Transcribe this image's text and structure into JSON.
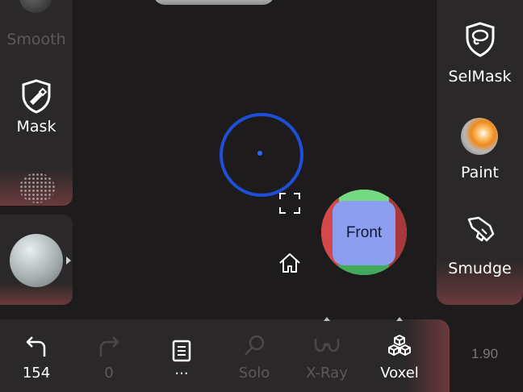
{
  "left_tools": {
    "smooth_label": "Smooth",
    "mask_label": "Mask"
  },
  "right_tools": {
    "selmask_label": "SelMask",
    "paint_label": "Paint",
    "smudge_label": "Smudge"
  },
  "view_cube": {
    "front_label": "Front"
  },
  "toolbar": {
    "undo_count": "154",
    "redo_count": "0",
    "menu_label": "...",
    "solo_label": "Solo",
    "xray_label": "X-Ray",
    "voxel_label": "Voxel"
  },
  "brush_size": "1.90",
  "colors": {
    "panel": "#2a2828",
    "panel_glow": "#6b3a3d",
    "brush_ring": "#1f4fd8",
    "cube_front": "#8b9ef0",
    "cube_green": "#51c96c",
    "cube_red": "#d6474a"
  },
  "icons": {
    "smooth": "smooth-icon",
    "mask": "shield-brush-icon",
    "stylus": "stylus-icon",
    "selmask": "shield-lasso-icon",
    "paint": "paint-ball-icon",
    "smudge": "smudge-hand-icon",
    "frame": "frame-icon",
    "home": "home-icon",
    "undo": "undo-icon",
    "redo": "redo-icon",
    "menu": "book-icon",
    "solo": "magnifier-icon",
    "xray": "glasses-icon",
    "voxel": "cubes-icon"
  }
}
